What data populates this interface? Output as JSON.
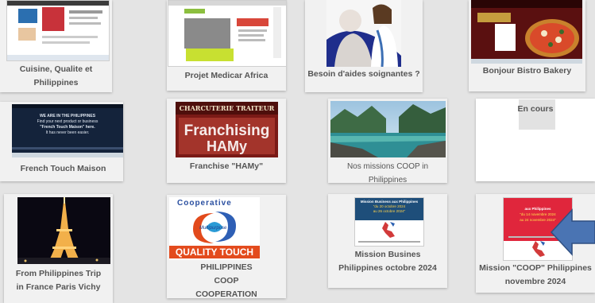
{
  "cards": [
    {
      "label": "Cuisine, Qualite et Philippines"
    },
    {
      "label": "Projet Medicar Africa"
    },
    {
      "label": "Besoin d'aides soignantes ?"
    },
    {
      "label": "Bonjour Bistro Bakery"
    },
    {
      "label": "French Touch Maison",
      "thumb": {
        "line1": "WE ARE IN THE PHILIPPINES",
        "line2": "Find your next product or business",
        "line3": "\"French Touch Maison\" here.",
        "line4": "It has never been easier."
      }
    },
    {
      "label": "Franchise \"HAMy\"",
      "thumb": {
        "sign": "CHARCUTERIE  TRAITEUR",
        "word1": "Franchising",
        "word2": "HAMy"
      }
    },
    {
      "label": "Nos missions COOP in Philippines"
    },
    {
      "label": "En cours"
    },
    {
      "label": "From Philippines Trip in France Paris Vichy"
    },
    {
      "label": "PHILIPPINES COOP COOPERATION",
      "thumb": {
        "top": "Cooperative",
        "mid": "Multipurpose",
        "bottom": "QUALITY TOUCH"
      }
    },
    {
      "label": "Mission Busines Philippines octobre 2024",
      "thumb": {
        "line1": "Mission Business aux Philippines",
        "line2": "\"du 20 octobre 2024",
        "line3": "au 26 octobre 2024\""
      }
    },
    {
      "label": "Mission \"COOP\" Philippines novembre 2024",
      "thumb": {
        "line1": "aux Philippines",
        "line2": "\"du 14 novembre 2024",
        "line3": "au 24 novembre 2024\""
      }
    }
  ],
  "colors": {
    "arrow": "#4a74b3",
    "page_bg": "#e4e4e4",
    "card_bg": "#f1f1f1",
    "caption": "#555555"
  }
}
